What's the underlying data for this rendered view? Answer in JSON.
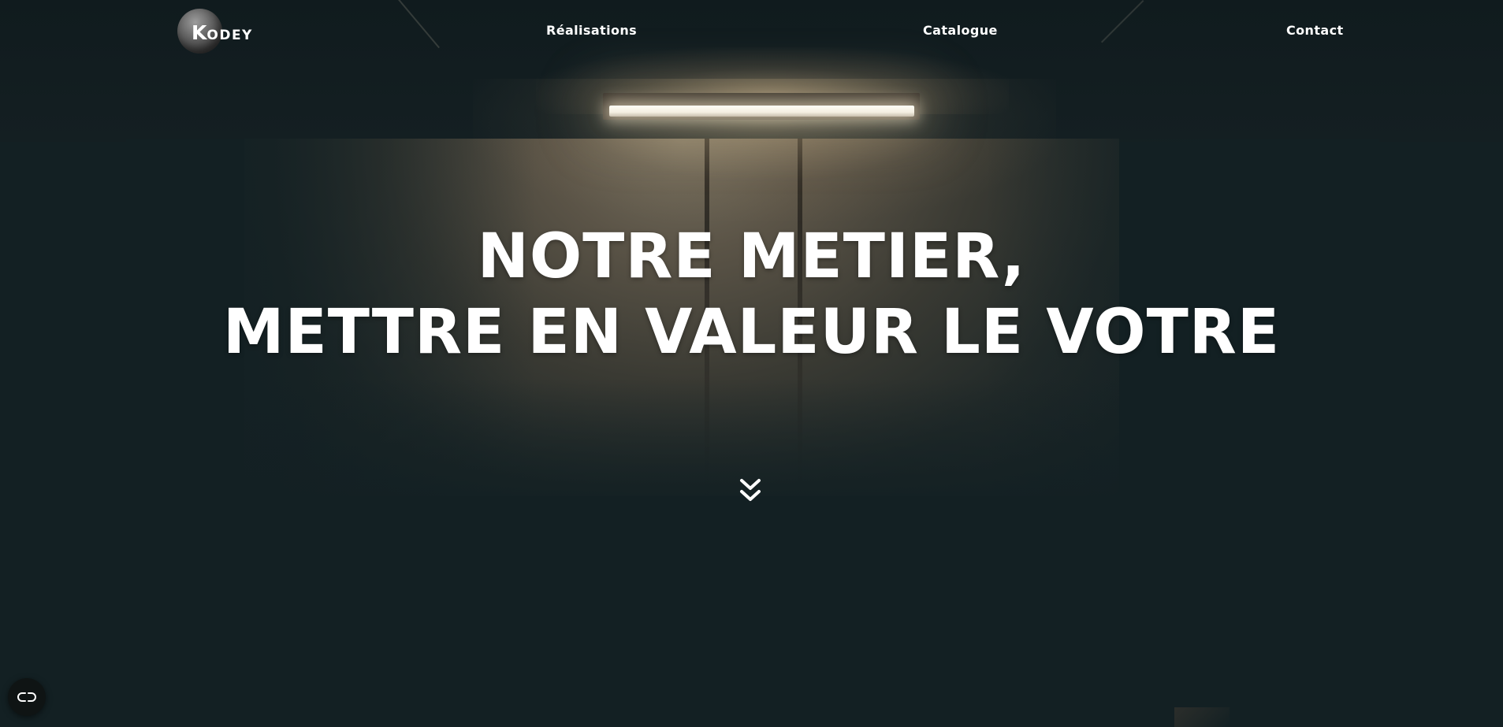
{
  "nav": {
    "logo_initial": "K",
    "logo_rest": "ODEY",
    "links": [
      {
        "label": "Réalisations"
      },
      {
        "label": "Catalogue"
      },
      {
        "label": "Contact"
      }
    ]
  },
  "hero": {
    "headline_line1": "NOTRE METIER,",
    "headline_line2": "METTRE EN VALEUR LE VOTRE",
    "scroll_icon": "double-chevron-down-icon"
  },
  "floating_button": {
    "icon": "link-icon"
  },
  "colors": {
    "background": "#132023",
    "text": "#ffffff",
    "wall": "#5b5447",
    "lamp": "#fffdf5"
  }
}
